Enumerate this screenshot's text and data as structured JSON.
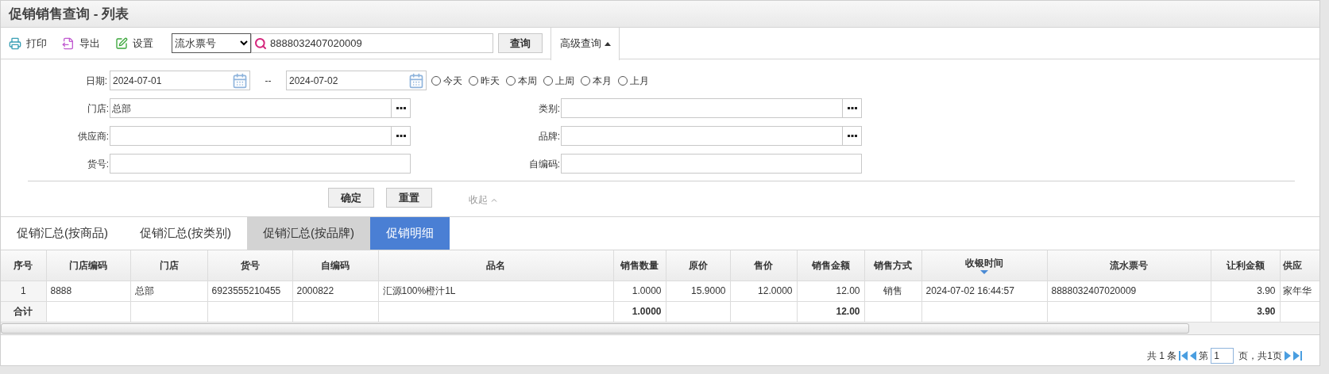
{
  "title": "促销销售查询 - 列表",
  "toolbar": {
    "buttons": [
      {
        "label": "打印",
        "kind": "print"
      },
      {
        "label": "导出",
        "kind": "export"
      },
      {
        "label": "设置",
        "kind": "settings"
      }
    ],
    "search_type": "流水票号",
    "search_value": "8888032407020009",
    "query_button": "查询",
    "advanced_tab": {
      "label": "高级查询",
      "expanded": true
    }
  },
  "form": {
    "date_label": "日期:",
    "date_from": "2024-07-01",
    "date_separator": "--",
    "date_to": "2024-07-02",
    "quick_ranges": [
      {
        "label": "今天",
        "selected": false
      },
      {
        "label": "昨天",
        "selected": false
      },
      {
        "label": "本周",
        "selected": false
      },
      {
        "label": "上周",
        "selected": false
      },
      {
        "label": "本月",
        "selected": false
      },
      {
        "label": "上月",
        "selected": false
      }
    ],
    "fields": [
      {
        "label": "门店:",
        "value": "总部",
        "kind": "picker"
      },
      {
        "label": "类别:",
        "kind": "picker"
      },
      {
        "label": "供应商:",
        "kind": "picker"
      },
      {
        "label": "品牌:",
        "kind": "picker"
      },
      {
        "label": "货号:",
        "kind": "text"
      },
      {
        "label": "自编码:",
        "kind": "text"
      }
    ],
    "confirm_button": "确定",
    "reset_button": "重置",
    "collapse_link": "收起"
  },
  "tabs": [
    {
      "label": "促销汇总(按商品)",
      "selected": false,
      "hovered": false
    },
    {
      "label": "促销汇总(按类别)",
      "selected": false,
      "hovered": false
    },
    {
      "label": "促销汇总(按品牌)",
      "selected": false,
      "hovered": true
    },
    {
      "label": "促销明细",
      "selected": true,
      "hovered": false
    }
  ],
  "table": {
    "columns": [
      {
        "label": "序号",
        "sorted": false
      },
      {
        "label": "门店编码",
        "sorted": false
      },
      {
        "label": "门店",
        "sorted": false
      },
      {
        "label": "货号",
        "sorted": false
      },
      {
        "label": "自编码",
        "sorted": false
      },
      {
        "label": "品名",
        "sorted": false
      },
      {
        "label": "销售数量",
        "sorted": false
      },
      {
        "label": "原价",
        "sorted": false
      },
      {
        "label": "售价",
        "sorted": false
      },
      {
        "label": "销售金额",
        "sorted": false
      },
      {
        "label": "销售方式",
        "sorted": false
      },
      {
        "label": "收银时间",
        "sorted": true
      },
      {
        "label": "流水票号",
        "sorted": false
      },
      {
        "label": "让利金额",
        "sorted": false
      },
      {
        "label": "供应",
        "sorted": false
      }
    ],
    "rows": [
      [
        "1",
        "8888",
        "总部",
        "6923555210455",
        "2000822",
        "汇源100%橙汁1L",
        "1.0000",
        "15.9000",
        "12.0000",
        "12.00",
        "销售",
        "2024-07-02 16:44:57",
        "8888032407020009",
        "3.90",
        "家年华"
      ]
    ],
    "total_row": {
      "label": "合计",
      "quantity": "1.0000",
      "amount": "12.00",
      "discount": "3.90"
    }
  },
  "pager": {
    "total": "共 1 条",
    "page_prefix": "第",
    "page": "1",
    "page_suffix": "页，共1页"
  }
}
